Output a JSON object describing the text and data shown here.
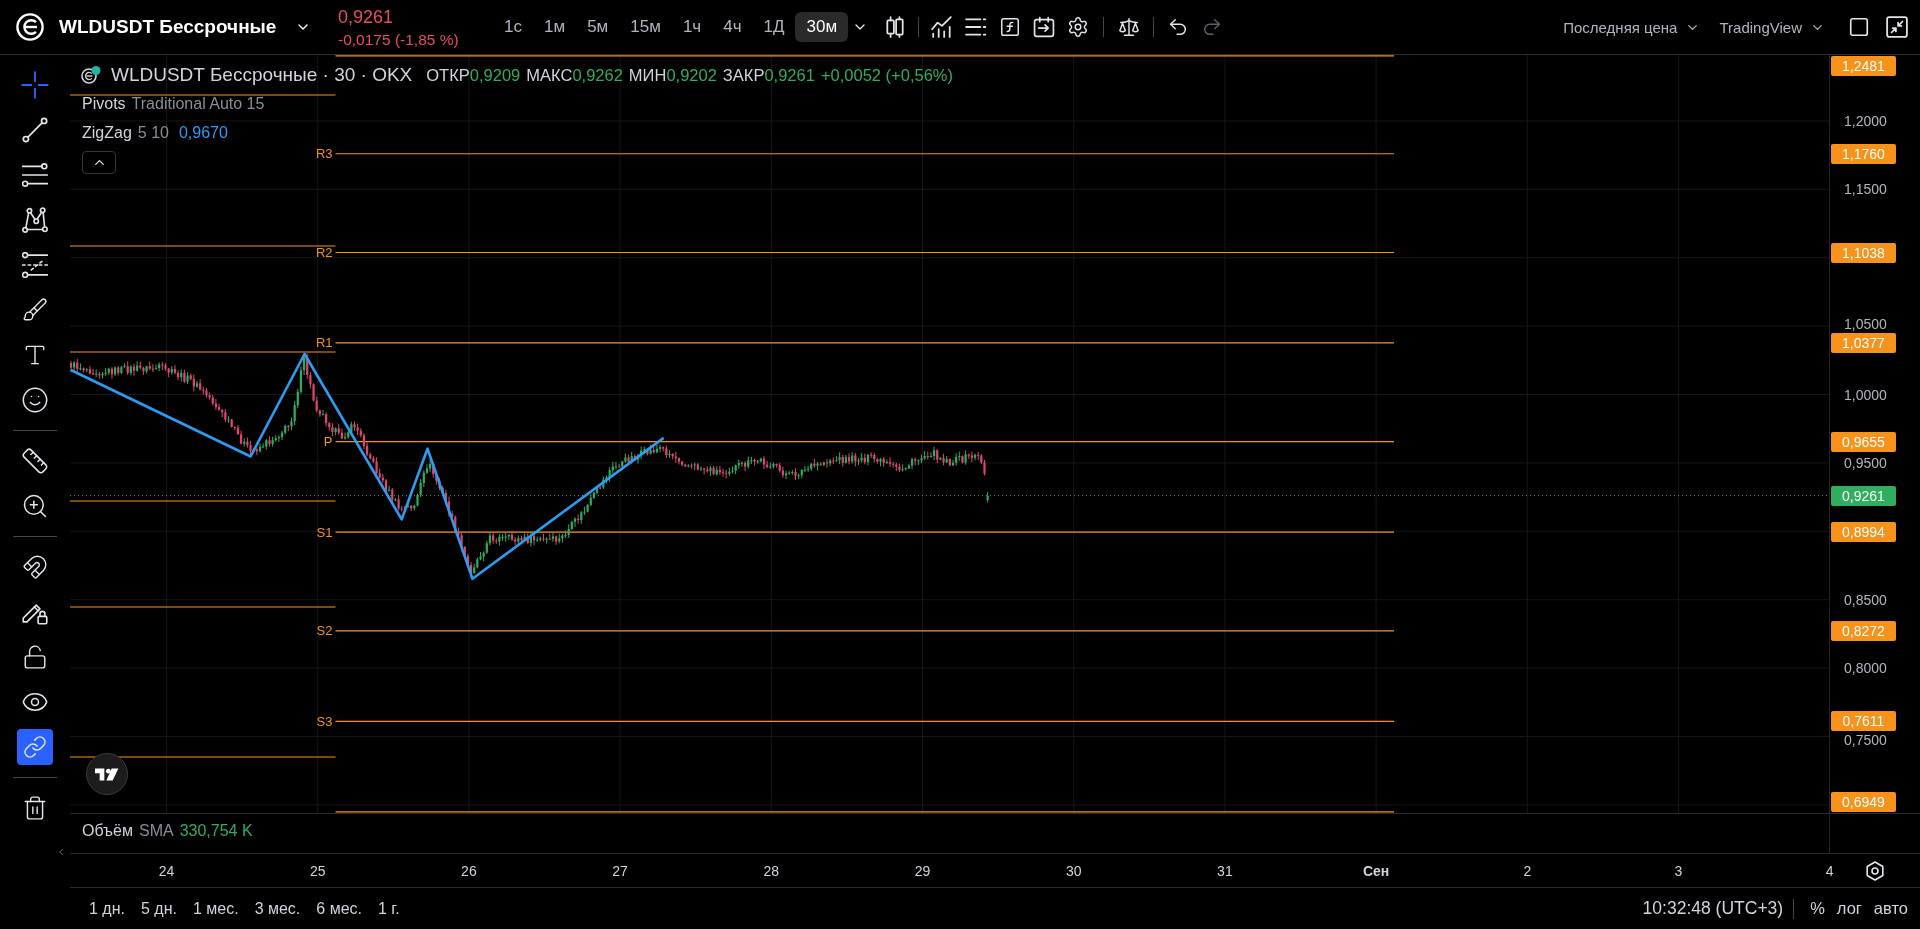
{
  "header": {
    "symbol": "WLDUSDT Бессрочные",
    "last_price": "0,9261",
    "change": "-0,0175 (-1,85 %)",
    "change_negative": true,
    "timeframes": [
      {
        "label": "1с",
        "selected": false
      },
      {
        "label": "1м",
        "selected": false
      },
      {
        "label": "5м",
        "selected": false
      },
      {
        "label": "15м",
        "selected": false
      },
      {
        "label": "1ч",
        "selected": false
      },
      {
        "label": "4ч",
        "selected": false
      },
      {
        "label": "1Д",
        "selected": false
      },
      {
        "label": "30м",
        "selected": true
      }
    ],
    "history": [
      {
        "kind": "undo",
        "disabled": false
      },
      {
        "kind": "redo",
        "disabled": true
      }
    ],
    "price_source": "Последняя цена",
    "provider": "TradingView"
  },
  "left_toolbar": {
    "groups": [
      {
        "tools": [
          {
            "kind": "crosshair",
            "selected": true
          },
          {
            "kind": "trend-line",
            "selected": false
          },
          {
            "kind": "parallel-lines",
            "selected": false
          },
          {
            "kind": "pattern",
            "selected": false
          },
          {
            "kind": "projection",
            "selected": false
          },
          {
            "kind": "brush",
            "selected": false
          },
          {
            "kind": "text",
            "selected": false
          },
          {
            "kind": "emoji",
            "selected": false
          }
        ]
      },
      {
        "tools": [
          {
            "kind": "ruler",
            "selected": false
          },
          {
            "kind": "zoom",
            "selected": false
          }
        ]
      }
    ],
    "toggles": [
      {
        "kind": "magnet",
        "on": false
      },
      {
        "kind": "draw-lock",
        "on": false
      },
      {
        "kind": "lock",
        "on": false
      },
      {
        "kind": "visibility",
        "on": false
      },
      {
        "kind": "sync",
        "on": true
      }
    ]
  },
  "legend": {
    "title": "WLDUSDT Бессрочные · 30 · OKX",
    "bar_rising": true,
    "ohlc": [
      {
        "label": "ОТКР",
        "value": "0,9209"
      },
      {
        "label": "МАКС",
        "value": "0,9262"
      },
      {
        "label": "МИН",
        "value": "0,9202"
      },
      {
        "label": "ЗАКР",
        "value": "0,9261"
      }
    ],
    "change": "+0,0052 (+0,56%)",
    "indicators": [
      {
        "name": "Pivots",
        "params": "Traditional Auto 15"
      },
      {
        "name": "ZigZag",
        "params": "5 10",
        "value": "0,9670"
      }
    ],
    "expanded": true
  },
  "chart": {
    "pivots": [
      {
        "price": "1,2481"
      },
      {
        "label": "R3",
        "price": "1,1760"
      },
      {
        "label": "R2",
        "price": "1,1038"
      },
      {
        "label": "R1",
        "price": "1,0377"
      },
      {
        "label": "P",
        "price": "0,9655"
      },
      {
        "label": "S1",
        "price": "0,8994"
      },
      {
        "label": "S2",
        "price": "0,8272"
      },
      {
        "label": "S3",
        "price": "0,7611"
      },
      {
        "price": "0,6949"
      }
    ],
    "last_price": "0,9261",
    "price_ticks": [
      "1,2000",
      "1,1500",
      "1,0500",
      "1,0000",
      "0,9500",
      "0,8500",
      "0,8000",
      "0,7500"
    ]
  },
  "volume": {
    "name": "Объём",
    "params": "SMA",
    "value": "330,754 K"
  },
  "time_axis": [
    {
      "text": "24",
      "kind": "day"
    },
    {
      "text": "25",
      "kind": "day"
    },
    {
      "text": "26",
      "kind": "day"
    },
    {
      "text": "27",
      "kind": "day"
    },
    {
      "text": "28",
      "kind": "day"
    },
    {
      "text": "29",
      "kind": "day"
    },
    {
      "text": "30",
      "kind": "day"
    },
    {
      "text": "31",
      "kind": "day"
    },
    {
      "text": "Сен",
      "kind": "month"
    },
    {
      "text": "2",
      "kind": "day"
    },
    {
      "text": "3",
      "kind": "day"
    },
    {
      "text": "4",
      "kind": "day"
    }
  ],
  "bottom_bar": {
    "ranges": [
      "1 дн.",
      "5 дн.",
      "1 мес.",
      "3 мес.",
      "6 мес.",
      "1 г."
    ],
    "clock": "10:32:48 (UTC+3)",
    "scale_options": [
      "%",
      "лог",
      "авто"
    ]
  }
}
